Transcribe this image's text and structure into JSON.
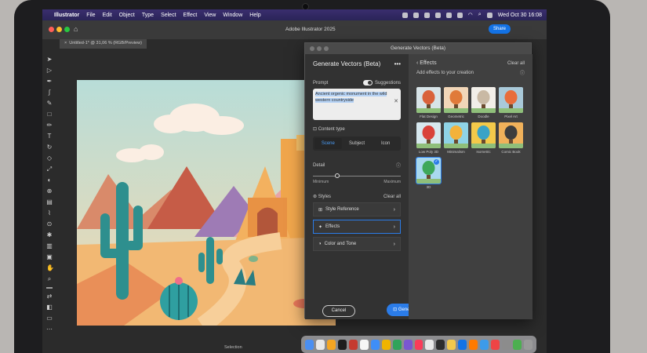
{
  "menubar": {
    "app_name": "Illustrator",
    "items": [
      "File",
      "Edit",
      "Object",
      "Type",
      "Select",
      "Effect",
      "View",
      "Window",
      "Help"
    ],
    "clock": "Wed Oct 30  16:08"
  },
  "app": {
    "title": "Adobe Illustrator 2025",
    "share": "Share",
    "doc_tab": "Untitled-1* @ 31,06 % (RGB/Preview)"
  },
  "dialog": {
    "window_title": "Generate Vectors (Beta)",
    "panel_title": "Generate Vectors (Beta)",
    "more": "•••",
    "prompt_label": "Prompt",
    "suggestions_label": "Suggestions",
    "prompt_text_line1": "Ancient orgenic monument in the wild",
    "prompt_text_line2": "western countryside",
    "content_type_label": "Content type",
    "content_types": [
      "Scene",
      "Subject",
      "Icon"
    ],
    "detail_label": "Detail",
    "detail_min": "Minimum",
    "detail_max": "Maximum",
    "styles_label": "Styles",
    "clear_all": "Clear all",
    "style_items": [
      "Style Reference",
      "Effects",
      "Color and Tone"
    ],
    "cancel": "Cancel",
    "generate": "Generate"
  },
  "effects": {
    "title": "Effects",
    "clear_all": "Clear all",
    "subtitle": "Add effects to your creation",
    "items": [
      {
        "name": "Flat Design",
        "c1": "#d8e4e8",
        "c2": "#d9623b"
      },
      {
        "name": "Geometric",
        "c1": "#f1d6b8",
        "c2": "#e07a3a"
      },
      {
        "name": "Doodle",
        "c1": "#f2efe9",
        "c2": "#c9b9a4"
      },
      {
        "name": "Pixel Art",
        "c1": "#a9c9d9",
        "c2": "#e86d3b"
      },
      {
        "name": "Low Poly 3D",
        "c1": "#d7e8ef",
        "c2": "#d9423a"
      },
      {
        "name": "Minimalism",
        "c1": "#8fd3e6",
        "c2": "#f3b23a"
      },
      {
        "name": "Isometric",
        "c1": "#f3c94a",
        "c2": "#3aa3c7"
      },
      {
        "name": "Comic Book",
        "c1": "#f0b15a",
        "c2": "#3d3d3d"
      },
      {
        "name": "3D",
        "c1": "#a9d9ee",
        "c2": "#3ea85a"
      }
    ]
  },
  "status": {
    "selection": "Selection"
  },
  "dock": {
    "colors": [
      "#4a8ff2",
      "#e9e9e9",
      "#f5a623",
      "#1e1e1e",
      "#c53a2f",
      "#f6f6f6",
      "#3e8ef7",
      "#f0b400",
      "#2fa35a",
      "#7a57d1",
      "#fa3c5a",
      "#e9e9e9",
      "#2d2d2d",
      "#f2c94c",
      "#1473e6",
      "#ff7a00",
      "#3d9be9",
      "#ee4545",
      "#8c8c8c",
      "#4caf50",
      "#9a9a9a"
    ]
  }
}
